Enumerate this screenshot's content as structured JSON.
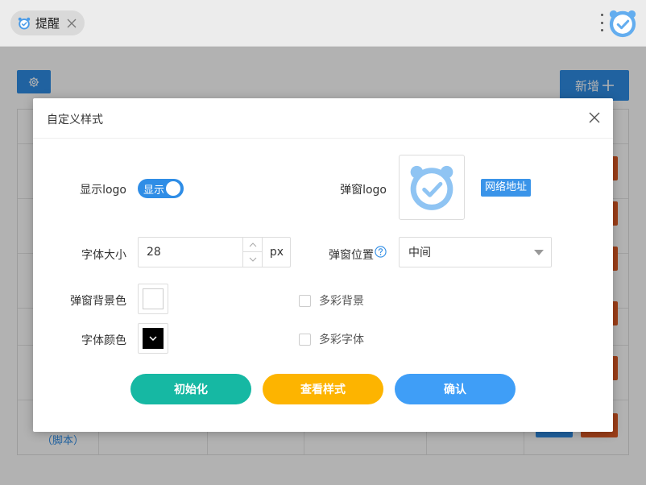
{
  "tab": {
    "label": "提醒",
    "icon": "alarm-clock-icon",
    "close_icon": "close-icon"
  },
  "topbar": {
    "menu_icon": "kebab-menu-icon",
    "app_icon": "alarm-clock-icon"
  },
  "page": {
    "settings_icon": "gear-icon",
    "add_label": "新增",
    "add_icon": "plus-icon",
    "table_link": "（脚本）"
  },
  "modal": {
    "title": "自定义样式",
    "close_icon": "close-icon",
    "show_logo_label": "显示logo",
    "show_logo_toggle": "显示",
    "popup_logo_label": "弹窗logo",
    "popup_logo_icon": "alarm-clock-icon",
    "url_badge": "网络地址",
    "font_size_label": "字体大小",
    "font_size_value": "28",
    "font_size_unit": "px",
    "popup_position_label": "弹窗位置",
    "help_icon": "help-circle-icon",
    "popup_position_value": "中间",
    "bg_color_label": "弹窗背景色",
    "bg_color_value": "#ffffff",
    "multicolor_bg_label": "多彩背景",
    "font_color_label": "字体颜色",
    "font_color_value": "#000000",
    "multicolor_font_label": "多彩字体",
    "btn_init": "初始化",
    "btn_preview": "查看样式",
    "btn_confirm": "确认"
  },
  "colors": {
    "primary": "#2f8de6",
    "green": "#16b8a3",
    "yellow": "#fdb400",
    "blue": "#3f9ef7",
    "danger": "#e05a23",
    "logo_blue": "#8fc4f3"
  }
}
